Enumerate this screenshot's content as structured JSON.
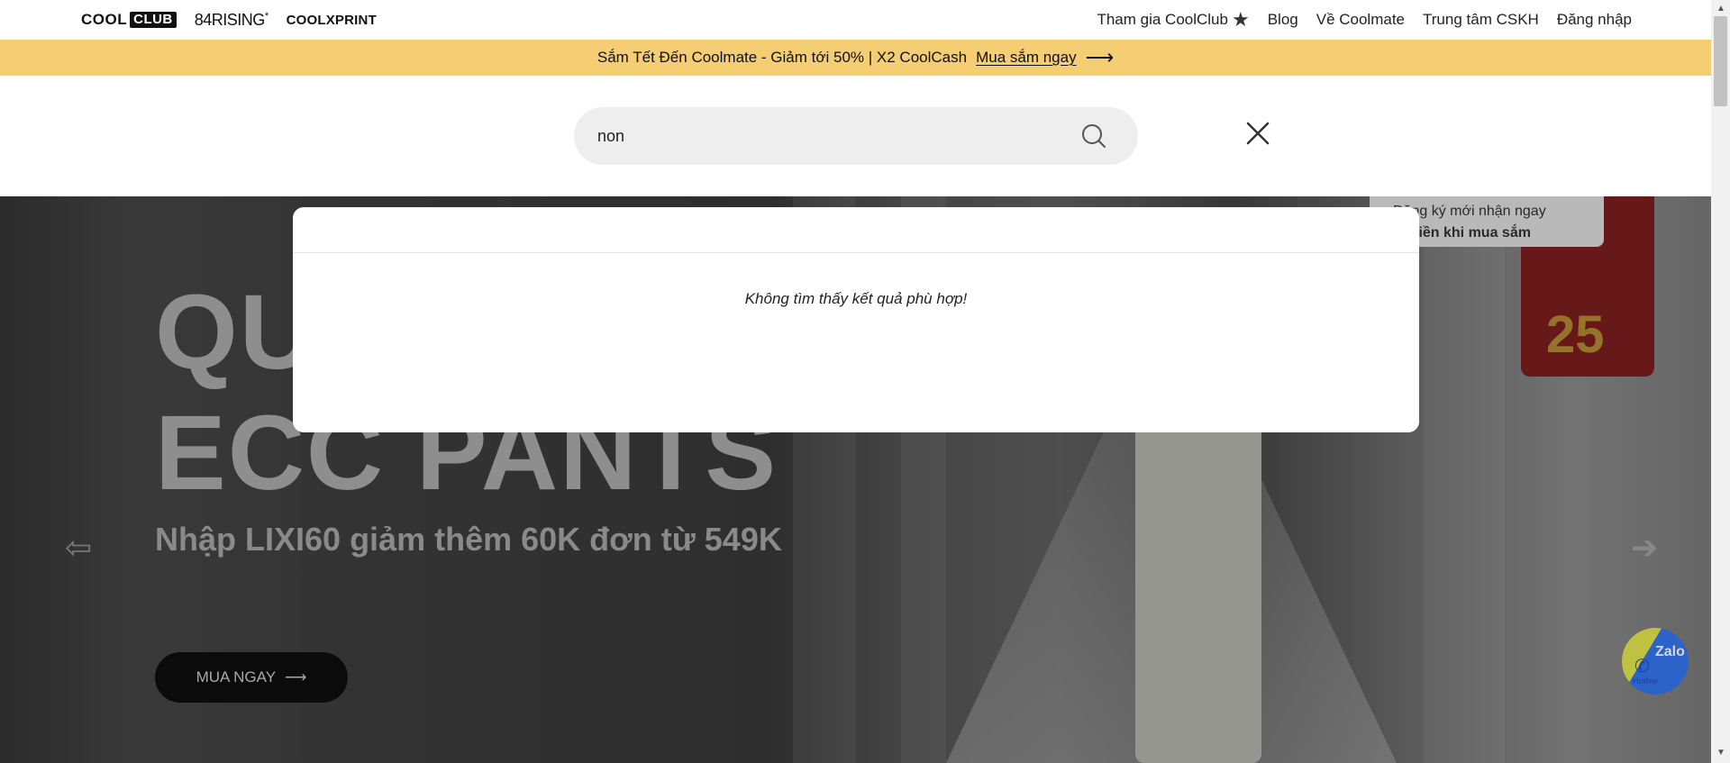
{
  "topbar": {
    "brands": {
      "coolclub_cool": "COOL",
      "coolclub_club": "CLUB",
      "rising": "84RISING",
      "rising_mark": "*",
      "coolxprint": "COOLXPRINT"
    },
    "nav": [
      {
        "label": "Tham gia CoolClub",
        "icon": "star-icon"
      },
      {
        "label": "Blog"
      },
      {
        "label": "Về Coolmate"
      },
      {
        "label": "Trung tâm CSKH"
      },
      {
        "label": "Đăng nhập"
      }
    ]
  },
  "promo": {
    "text": "Sắm Tết Đến Coolmate - Giảm tới 50% | X2 CoolCash",
    "link": "Mua sắm ngay",
    "color": "#f5cd72"
  },
  "search": {
    "value": "non",
    "placeholder": "",
    "icon": "search-icon",
    "close_icon": "close-icon"
  },
  "results": {
    "empty_message": "Không tìm thấy kết quả phù hợp!"
  },
  "hero": {
    "title_line1": "QU",
    "title_line2": "ECC PANTS",
    "subtitle_bold": "Nhập LIXI60",
    "subtitle_rest": " giảm thêm 60K đơn từ 549K",
    "cta": "MUA NGAY",
    "badge_text": "25",
    "signup_line1": "Đăng ký mới nhận ngay",
    "signup_line2": "an tiền khi mua sắm"
  },
  "zalo": {
    "label": "Zalo",
    "hotline": "Hotline"
  }
}
